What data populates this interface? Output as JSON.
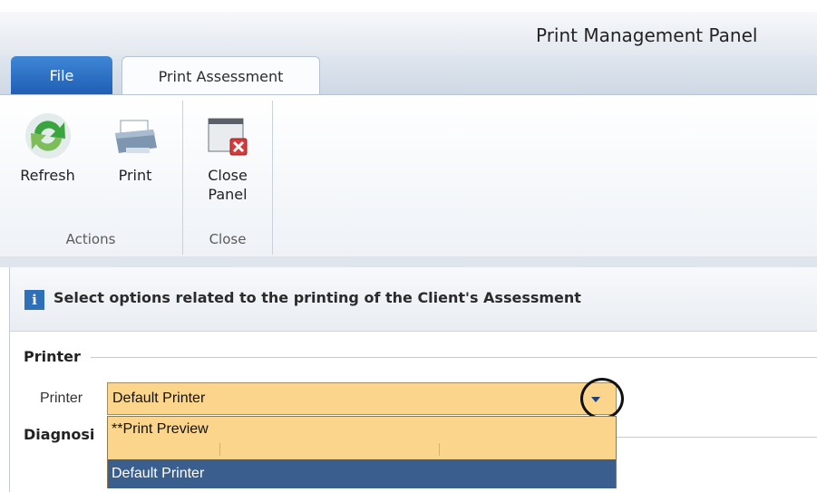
{
  "window": {
    "title": "Print Management Panel"
  },
  "ribbon": {
    "tabs": [
      {
        "label": "File"
      },
      {
        "label": "Print Assessment"
      }
    ],
    "groups": [
      {
        "label": "Actions",
        "buttons": [
          {
            "label": "Refresh",
            "icon": "refresh-icon"
          },
          {
            "label": "Print",
            "icon": "printer-icon"
          }
        ]
      },
      {
        "label": "Close",
        "buttons": [
          {
            "label_line1": "Close",
            "label_line2": "Panel",
            "icon": "close-panel-icon"
          }
        ]
      }
    ]
  },
  "info": {
    "message": "Select options related to the printing of the Client's Assessment",
    "icon": "info-icon"
  },
  "printer_section": {
    "title": "Printer",
    "field_label": "Printer",
    "selected_value": "Default Printer",
    "options": [
      {
        "label": "**Print Preview"
      },
      {
        "label": "Default Printer"
      }
    ]
  },
  "diagnosis_section": {
    "title": "Diagnosi"
  },
  "colors": {
    "combo_fill": "#fbd58c",
    "selection": "#3a5f8e",
    "file_tab": "#2a6ec4"
  }
}
